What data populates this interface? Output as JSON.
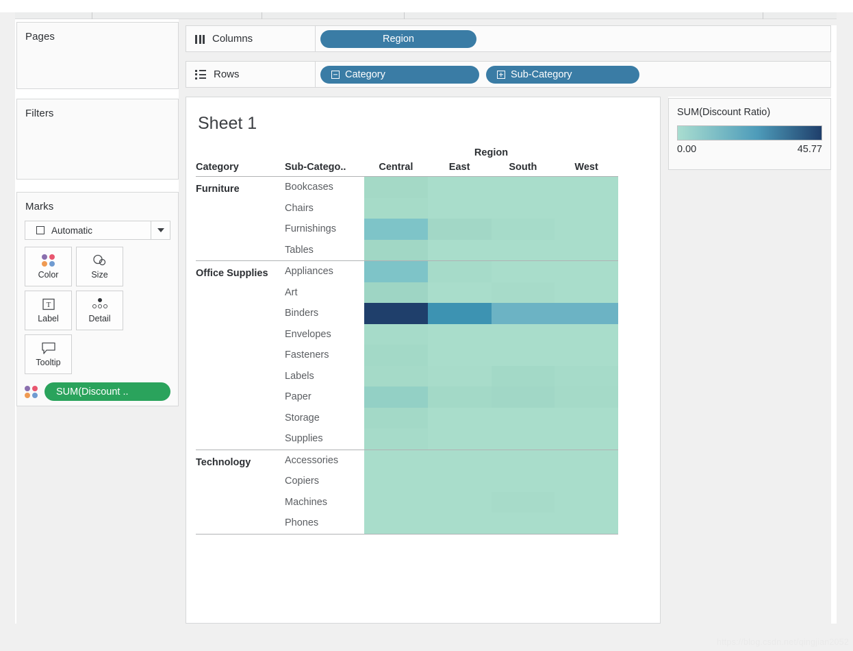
{
  "panels": {
    "pages": {
      "title": "Pages"
    },
    "filters": {
      "title": "Filters"
    },
    "marks": {
      "title": "Marks",
      "mark_type": "Automatic",
      "buttons": [
        {
          "label": "Color",
          "icon": "color-dots-icon"
        },
        {
          "label": "Size",
          "icon": "size-circles-icon"
        },
        {
          "label": "Label",
          "icon": "label-text-icon"
        },
        {
          "label": "Detail",
          "icon": "detail-dots-icon"
        },
        {
          "label": "Tooltip",
          "icon": "tooltip-bubble-icon"
        }
      ],
      "pill": "SUM(Discount .."
    }
  },
  "shelves": {
    "columns": {
      "label": "Columns",
      "icon": "columns-icon",
      "fields": [
        "Region"
      ]
    },
    "rows": {
      "label": "Rows",
      "icon": "rows-icon",
      "fields": [
        {
          "label": "Category",
          "expander": "minus"
        },
        {
          "label": "Sub-Category",
          "expander": "plus"
        }
      ]
    }
  },
  "viz": {
    "sheet_title": "Sheet 1"
  },
  "legend": {
    "title": "SUM(Discount Ratio)",
    "min_label": "0.00",
    "max_label": "45.77",
    "gradient_start": "#a9ddd0",
    "gradient_mid": "#4e9cba",
    "gradient_end": "#1f3f6b"
  },
  "watermark": "https://blog.csdn.net/qingjian2052",
  "chart_data": {
    "type": "heatmap",
    "title": "Sheet 1",
    "column_group_label": "Region",
    "row_headers": [
      "Category",
      "Sub-Catego.."
    ],
    "categories": [
      "Central",
      "East",
      "South",
      "West"
    ],
    "color_field": "SUM(Discount Ratio)",
    "color_min": 0.0,
    "color_max": 45.77,
    "rows": [
      {
        "category": "Furniture",
        "sub_category": "Bookcases",
        "values": [
          7.2,
          6.6,
          6.4,
          6.6
        ],
        "colors": [
          "#a4d9c6",
          "#a9ddcb",
          "#a9ddcb",
          "#a9ddcb"
        ]
      },
      {
        "category": "Furniture",
        "sub_category": "Chairs",
        "values": [
          7.0,
          6.8,
          6.5,
          6.6
        ],
        "colors": [
          "#a6dbc8",
          "#a9ddcb",
          "#a9ddcb",
          "#a9ddcb"
        ]
      },
      {
        "category": "Furniture",
        "sub_category": "Furnishings",
        "values": [
          17.5,
          7.4,
          7.0,
          6.8
        ],
        "colors": [
          "#7ec4c8",
          "#a2d7c6",
          "#a6dbc9",
          "#a9ddcb"
        ]
      },
      {
        "category": "Furniture",
        "sub_category": "Tables",
        "values": [
          7.6,
          6.7,
          6.5,
          6.6
        ],
        "colors": [
          "#a1d7c5",
          "#a9ddcb",
          "#a9ddcb",
          "#a9ddcb"
        ]
      },
      {
        "category": "Office Supplies",
        "sub_category": "Appliances",
        "values": [
          17.8,
          7.0,
          6.8,
          6.6
        ],
        "colors": [
          "#7ec4c8",
          "#a6dbc9",
          "#a9ddcb",
          "#a9ddcb"
        ]
      },
      {
        "category": "Office Supplies",
        "sub_category": "Art",
        "values": [
          8.0,
          6.8,
          6.8,
          6.6
        ],
        "colors": [
          "#9ed5c4",
          "#a9ddcb",
          "#a7dbc9",
          "#a9ddcb"
        ]
      },
      {
        "category": "Office Supplies",
        "sub_category": "Binders",
        "values": [
          45.77,
          30.5,
          24.5,
          24.0
        ],
        "colors": [
          "#1f3f6b",
          "#3d93b2",
          "#6cb3c4",
          "#6cb3c4"
        ]
      },
      {
        "category": "Office Supplies",
        "sub_category": "Envelopes",
        "values": [
          7.0,
          6.6,
          6.5,
          6.6
        ],
        "colors": [
          "#a6dbc9",
          "#a9ddcb",
          "#a9ddcb",
          "#a9ddcb"
        ]
      },
      {
        "category": "Office Supplies",
        "sub_category": "Fasteners",
        "values": [
          7.4,
          6.8,
          6.5,
          6.6
        ],
        "colors": [
          "#a3d9c7",
          "#a9ddcb",
          "#a9ddcb",
          "#a9ddcb"
        ]
      },
      {
        "category": "Office Supplies",
        "sub_category": "Labels",
        "values": [
          7.2,
          6.8,
          7.2,
          7.0
        ],
        "colors": [
          "#a5dac8",
          "#a8dcca",
          "#a3d9c7",
          "#a6dbc9"
        ]
      },
      {
        "category": "Office Supplies",
        "sub_category": "Paper",
        "values": [
          11.5,
          7.4,
          7.6,
          7.2
        ],
        "colors": [
          "#93d0c5",
          "#a3d9c7",
          "#a1d7c6",
          "#a5dac8"
        ]
      },
      {
        "category": "Office Supplies",
        "sub_category": "Storage",
        "values": [
          7.4,
          6.8,
          6.6,
          6.6
        ],
        "colors": [
          "#a3d9c7",
          "#a9ddcb",
          "#a9ddcb",
          "#a9ddcb"
        ]
      },
      {
        "category": "Office Supplies",
        "sub_category": "Supplies",
        "values": [
          7.0,
          6.6,
          6.5,
          6.6
        ],
        "colors": [
          "#a6dbc9",
          "#a9ddcb",
          "#a9ddcb",
          "#a9ddcb"
        ]
      },
      {
        "category": "Technology",
        "sub_category": "Accessories",
        "values": [
          6.8,
          6.6,
          6.5,
          6.6
        ],
        "colors": [
          "#a9ddcb",
          "#a9ddcb",
          "#a9ddcb",
          "#a9ddcb"
        ]
      },
      {
        "category": "Technology",
        "sub_category": "Copiers",
        "values": [
          6.8,
          6.6,
          6.5,
          6.6
        ],
        "colors": [
          "#a9ddcb",
          "#a9ddcb",
          "#a9ddcb",
          "#a9ddcb"
        ]
      },
      {
        "category": "Technology",
        "sub_category": "Machines",
        "values": [
          6.8,
          6.6,
          6.8,
          6.6
        ],
        "colors": [
          "#a9ddcb",
          "#a9ddcb",
          "#a7dbc9",
          "#a9ddcb"
        ]
      },
      {
        "category": "Technology",
        "sub_category": "Phones",
        "values": [
          6.8,
          6.6,
          6.5,
          6.6
        ],
        "colors": [
          "#a9ddcb",
          "#a9ddcb",
          "#a9ddcb",
          "#a9ddcb"
        ]
      }
    ]
  }
}
